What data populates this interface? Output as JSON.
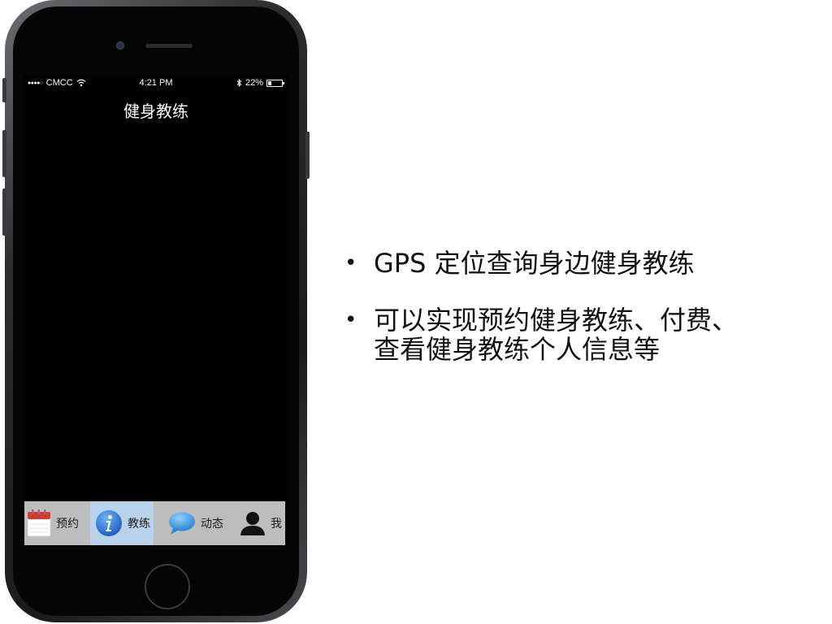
{
  "status_bar": {
    "carrier": "CMCC",
    "signal_dots": "●●●●○",
    "time": "4:21 PM",
    "battery_percent": "22%",
    "battery_level": 0.22
  },
  "nav": {
    "title": "健身教练"
  },
  "tabs": [
    {
      "label": "预约",
      "icon": "calendar-icon",
      "selected": false
    },
    {
      "label": "教练",
      "icon": "info-icon",
      "selected": true
    },
    {
      "label": "动态",
      "icon": "speech-bubble-icon",
      "selected": false
    },
    {
      "label": "我",
      "icon": "person-icon",
      "selected": false
    }
  ],
  "colors": {
    "tab_bar_bg": "#bdbdbd",
    "tab_selected_bg": "#b9d3ec",
    "info_icon_blue": "#1f6fd0",
    "bubble_blue": "#3b9be6"
  },
  "bullets": [
    {
      "text": "GPS 定位查询身边健身教练"
    },
    {
      "text": "可以实现预约健身教练、付费、查看健身教练个人信息等"
    }
  ]
}
